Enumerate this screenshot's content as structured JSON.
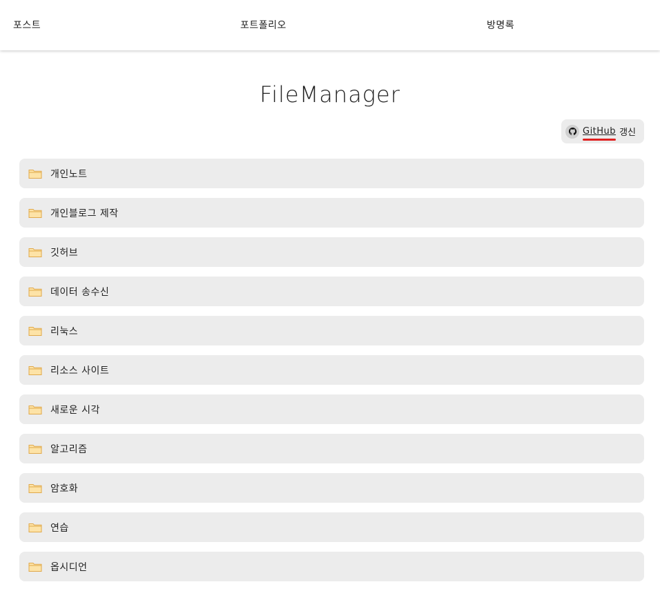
{
  "nav": {
    "items": [
      {
        "label": "포스트"
      },
      {
        "label": "포트폴리오"
      },
      {
        "label": "방명록"
      }
    ]
  },
  "page": {
    "title": "FileManager"
  },
  "github_button": {
    "link_text": "GitHub",
    "suffix": "갱신",
    "icon": "github-icon",
    "underline_color": "#e02020"
  },
  "folders": [
    {
      "name": "개인노트",
      "icon": "folder-icon"
    },
    {
      "name": "개인블로그 제작",
      "icon": "folder-icon"
    },
    {
      "name": "깃허브",
      "icon": "folder-icon"
    },
    {
      "name": "데이터 송수신",
      "icon": "folder-icon"
    },
    {
      "name": "리눅스",
      "icon": "folder-icon"
    },
    {
      "name": "리소스 사이트",
      "icon": "folder-icon"
    },
    {
      "name": "새로운 시각",
      "icon": "folder-icon"
    },
    {
      "name": "알고리즘",
      "icon": "folder-icon"
    },
    {
      "name": "암호화",
      "icon": "folder-icon"
    },
    {
      "name": "연습",
      "icon": "folder-icon"
    },
    {
      "name": "옵시디언",
      "icon": "folder-icon"
    }
  ],
  "colors": {
    "folder_fill": "#fde3a7",
    "folder_stroke": "#e0a84a",
    "item_background": "#ececec"
  }
}
